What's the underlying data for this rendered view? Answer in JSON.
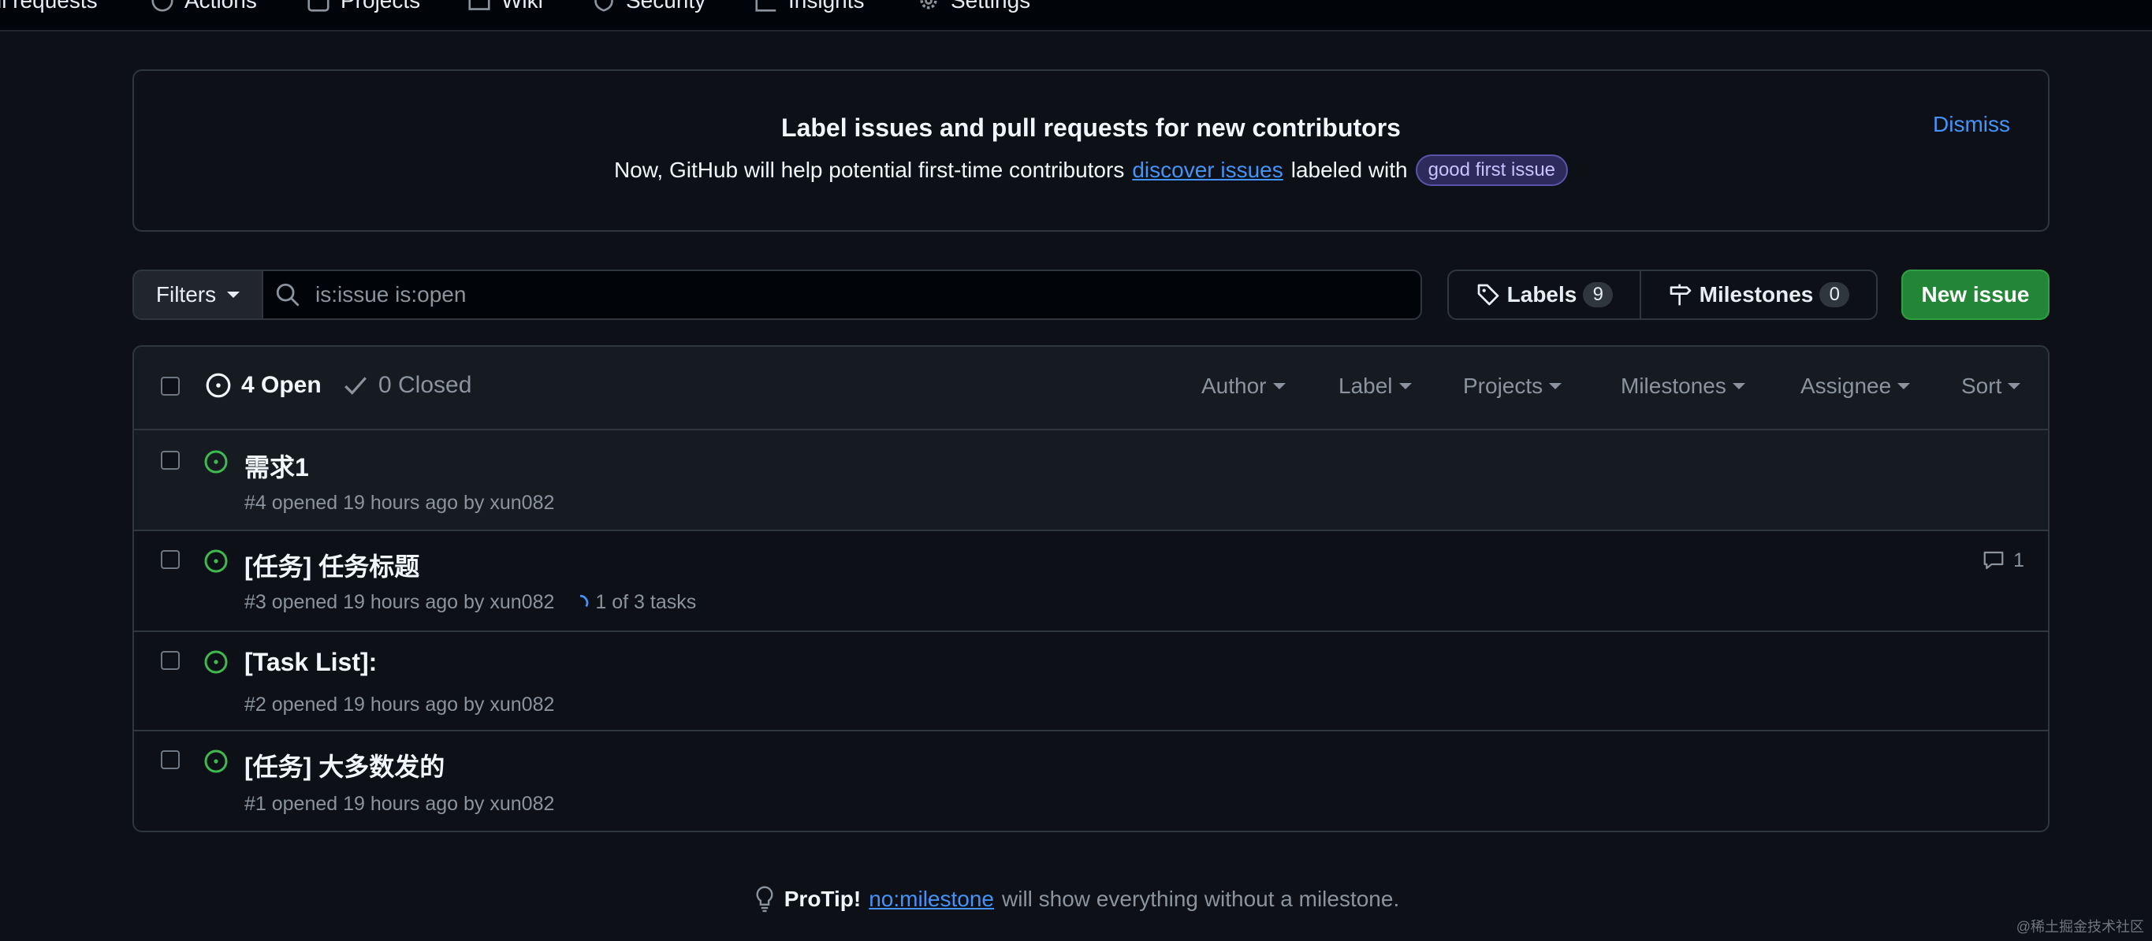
{
  "nav": {
    "items": [
      "ll requests",
      "Actions",
      "Projects",
      "Wiki",
      "Security",
      "Insights",
      "Settings"
    ]
  },
  "banner": {
    "title": "Label issues and pull requests for new contributors",
    "text_before": "Now, GitHub will help potential first-time contributors",
    "link": "discover issues",
    "text_after": "labeled with",
    "label": "good first issue",
    "dismiss": "Dismiss"
  },
  "toolbar": {
    "filters_label": "Filters",
    "search_value": "is:issue is:open",
    "labels_label": "Labels",
    "labels_count": "9",
    "milestones_label": "Milestones",
    "milestones_count": "0",
    "new_issue_label": "New issue"
  },
  "issues_header": {
    "open": "4 Open",
    "closed": "0 Closed",
    "filters": [
      "Author",
      "Label",
      "Projects",
      "Milestones",
      "Assignee",
      "Sort"
    ]
  },
  "issues": [
    {
      "title": "需求1",
      "meta": "#4 opened 19 hours ago by xun082",
      "tasks": "",
      "comments": ""
    },
    {
      "title": "[任务] 任务标题",
      "meta": "#3 opened 19 hours ago by xun082",
      "tasks": "1 of 3 tasks",
      "comments": "1"
    },
    {
      "title": "[Task List]:",
      "meta": "#2 opened 19 hours ago by xun082",
      "tasks": "",
      "comments": ""
    },
    {
      "title": "[任务] 大多数发的",
      "meta": "#1 opened 19 hours ago by xun082",
      "tasks": "",
      "comments": ""
    }
  ],
  "protip": {
    "label": "ProTip!",
    "link": "no:milestone",
    "text": "will show everything without a milestone."
  },
  "watermark": "@稀土掘金技术社区",
  "colors": {
    "background": "#0d1117",
    "accent_link": "#4493f8",
    "open_issue": "#3fb950",
    "primary_button": "#238636"
  }
}
